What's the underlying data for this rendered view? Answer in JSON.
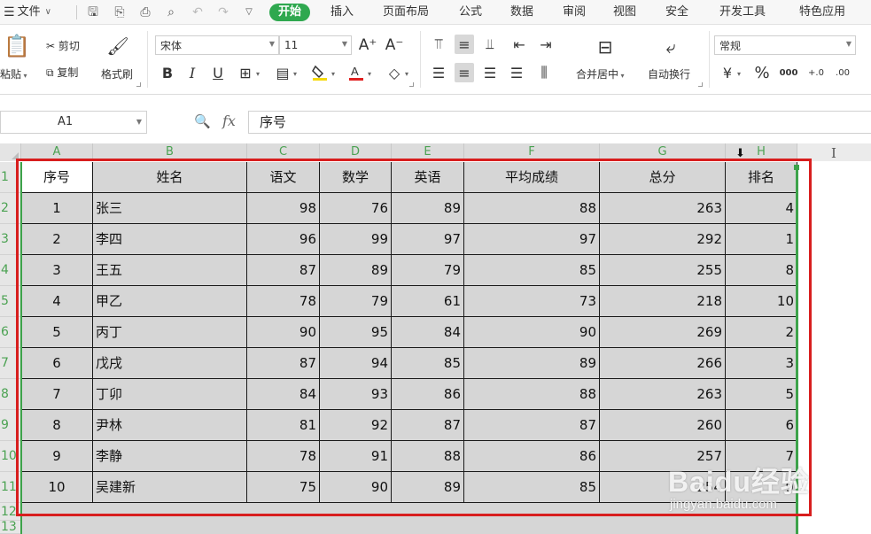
{
  "menubar": {
    "file_label": "文件",
    "tabs": [
      "开始",
      "插入",
      "页面布局",
      "公式",
      "数据",
      "审阅",
      "视图",
      "安全",
      "开发工具",
      "特色应用"
    ],
    "active_tab": "开始"
  },
  "ribbon": {
    "paste_label": "粘贴",
    "cut_label": "剪切",
    "copy_label": "复制",
    "format_painter_label": "格式刷",
    "font_name": "宋体",
    "font_size": "11",
    "merge_center_label": "合并居中",
    "wrap_text_label": "自动换行",
    "number_format": "常规",
    "accent_color": "#2fa84f",
    "font_color": "#e02020",
    "fill_color": "#f5d90a"
  },
  "formula_bar": {
    "cell_ref": "A1",
    "fx_label": "fx",
    "content": "序号"
  },
  "grid": {
    "columns": [
      "A",
      "B",
      "C",
      "D",
      "E",
      "F",
      "G",
      "H",
      "I"
    ],
    "rows": [
      "1",
      "2",
      "3",
      "4",
      "5",
      "6",
      "7",
      "8",
      "9",
      "10",
      "11",
      "12",
      "13"
    ],
    "headers": [
      "序号",
      "姓名",
      "语文",
      "数学",
      "英语",
      "平均成绩",
      "总分",
      "排名"
    ],
    "data": [
      [
        "1",
        "张三",
        "98",
        "76",
        "89",
        "88",
        "263",
        "4"
      ],
      [
        "2",
        "李四",
        "96",
        "99",
        "97",
        "97",
        "292",
        "1"
      ],
      [
        "3",
        "王五",
        "87",
        "89",
        "79",
        "85",
        "255",
        "8"
      ],
      [
        "4",
        "甲乙",
        "78",
        "79",
        "61",
        "73",
        "218",
        "10"
      ],
      [
        "5",
        "丙丁",
        "90",
        "95",
        "84",
        "90",
        "269",
        "2"
      ],
      [
        "6",
        "戊戌",
        "87",
        "94",
        "85",
        "89",
        "266",
        "3"
      ],
      [
        "7",
        "丁卯",
        "84",
        "93",
        "86",
        "88",
        "263",
        "5"
      ],
      [
        "8",
        "尹林",
        "81",
        "92",
        "87",
        "87",
        "260",
        "6"
      ],
      [
        "9",
        "李静",
        "78",
        "91",
        "88",
        "86",
        "257",
        "7"
      ],
      [
        "10",
        "吴建新",
        "75",
        "90",
        "89",
        "85",
        "254",
        "9"
      ]
    ],
    "selection_border_color": "#3da34a",
    "highlight_box_color": "#d81e1e"
  },
  "watermark": {
    "text": "Baidu经验",
    "url": "jingyan.baidu.com"
  }
}
